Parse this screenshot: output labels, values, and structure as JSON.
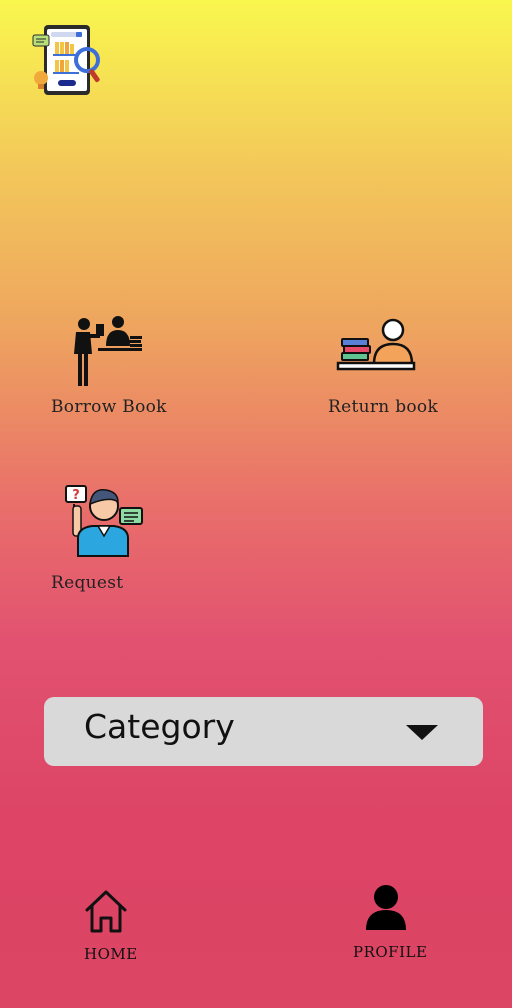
{
  "app": {
    "logo_icon": "library-app-logo-icon"
  },
  "actions": [
    {
      "id": "borrow",
      "label": "Borrow Book",
      "icon": "borrow-book-icon"
    },
    {
      "id": "return",
      "label": "Return book",
      "icon": "return-book-icon"
    },
    {
      "id": "request",
      "label": "Request",
      "icon": "request-icon"
    }
  ],
  "category": {
    "label": "Category",
    "icon": "caret-down-icon"
  },
  "bottom_nav": {
    "home_label": "HOME",
    "home_icon": "home-icon",
    "profile_label": "PROFILE",
    "profile_icon": "person-icon"
  },
  "colors": {
    "gradient_top": "#f9f74e",
    "gradient_mid": "#eea45f",
    "gradient_bottom": "#dc4563",
    "dropdown_bg": "#d9d9d9"
  }
}
